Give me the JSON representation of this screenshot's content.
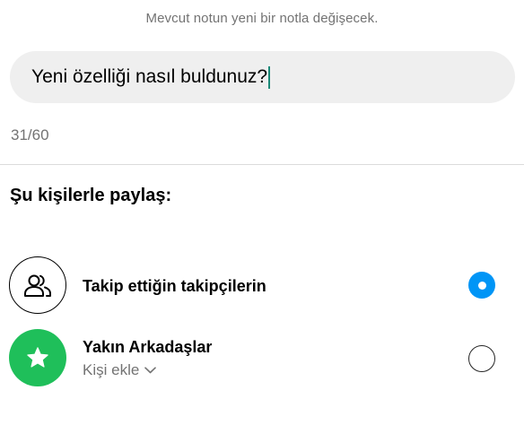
{
  "notice": "Mevcut notun yeni bir notla değişecek.",
  "note": {
    "value": "Yeni özelliği nasıl buldunuz?",
    "counter": "31/60"
  },
  "share": {
    "title": "Şu kişilerle paylaş:",
    "options": [
      {
        "label": "Takip ettiğin takipçilerin",
        "icon": "people-outline-icon",
        "selected": true
      },
      {
        "label": "Yakın Arkadaşlar",
        "sublabel": "Kişi ekle",
        "icon": "star-icon",
        "selected": false
      }
    ]
  },
  "colors": {
    "accent": "#0095f6",
    "close_friends": "#1fbf5a",
    "caret": "#1a8a78",
    "secondary_text": "#737373",
    "input_bg": "#efefef"
  }
}
